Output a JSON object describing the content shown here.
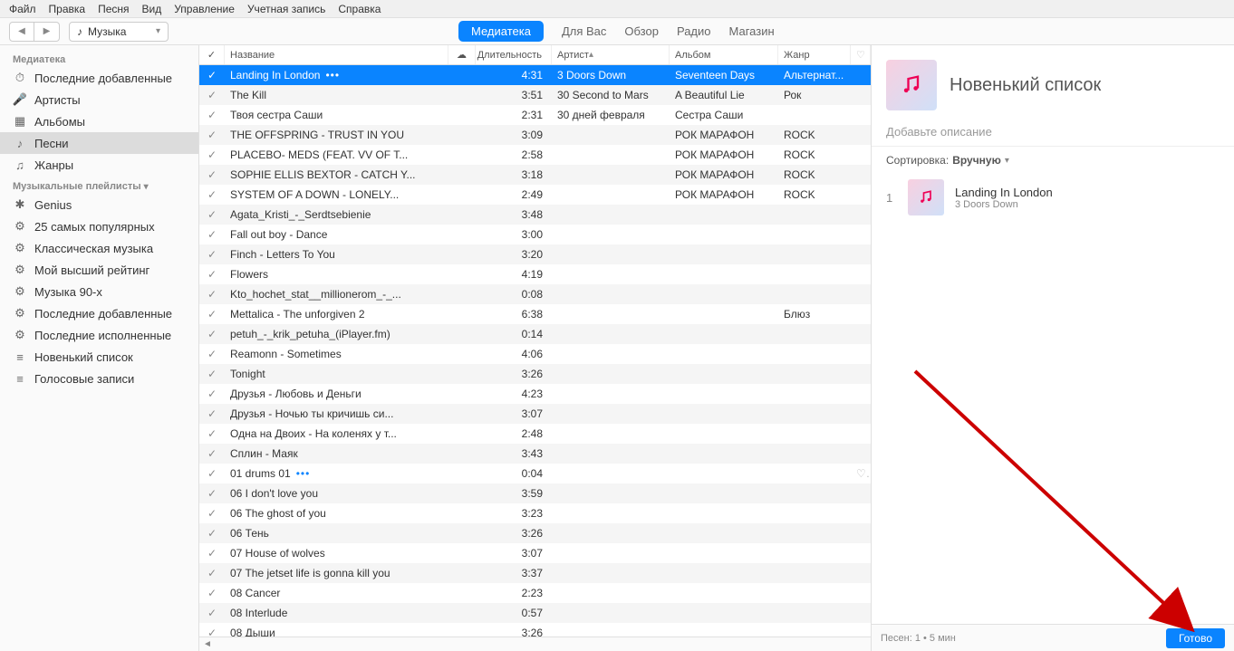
{
  "menu": [
    "Файл",
    "Правка",
    "Песня",
    "Вид",
    "Управление",
    "Учетная запись",
    "Справка"
  ],
  "mediaSelector": {
    "label": "Музыка"
  },
  "topTabs": [
    {
      "label": "Медиатека",
      "active": true
    },
    {
      "label": "Для Вас",
      "active": false
    },
    {
      "label": "Обзор",
      "active": false
    },
    {
      "label": "Радио",
      "active": false
    },
    {
      "label": "Магазин",
      "active": false
    }
  ],
  "sidebar": {
    "libraryHeader": "Медиатека",
    "libraryItems": [
      {
        "label": "Последние добавленные",
        "icon": "clock"
      },
      {
        "label": "Артисты",
        "icon": "mic"
      },
      {
        "label": "Альбомы",
        "icon": "album"
      },
      {
        "label": "Песни",
        "icon": "note",
        "selected": true
      },
      {
        "label": "Жанры",
        "icon": "genre"
      }
    ],
    "playlistsHeader": "Музыкальные плейлисты",
    "playlistItems": [
      {
        "label": "Genius",
        "icon": "atom"
      },
      {
        "label": "25 самых популярных",
        "icon": "gear"
      },
      {
        "label": "Классическая музыка",
        "icon": "gear"
      },
      {
        "label": "Мой высший рейтинг",
        "icon": "gear"
      },
      {
        "label": "Музыка 90-х",
        "icon": "gear"
      },
      {
        "label": "Последние добавленные",
        "icon": "gear"
      },
      {
        "label": "Последние исполненные",
        "icon": "gear"
      },
      {
        "label": "Новенький список",
        "icon": "list"
      },
      {
        "label": "Голосовые записи",
        "icon": "list"
      }
    ]
  },
  "columns": {
    "name": "Название",
    "cloud": "",
    "duration": "Длительность",
    "artist": "Артист",
    "album": "Альбом",
    "genre": "Жанр"
  },
  "rows": [
    {
      "name": "Landing In London",
      "dur": "4:31",
      "artist": "3 Doors Down",
      "album": "Seventeen Days",
      "genre": "Альтернат...",
      "selected": true,
      "dots": true
    },
    {
      "name": "The Kill",
      "dur": "3:51",
      "artist": "30 Second to Mars",
      "album": "A Beautiful Lie",
      "genre": "Рок"
    },
    {
      "name": "Твоя сестра Саши",
      "dur": "2:31",
      "artist": "30 дней февраля",
      "album": "Сестра Саши",
      "genre": ""
    },
    {
      "name": "THE OFFSPRING - TRUST IN YOU",
      "dur": "3:09",
      "artist": "",
      "album": "РОК МАРАФОН",
      "genre": "ROCK"
    },
    {
      "name": "PLACEBO- MEDS (FEAT. VV OF T...",
      "dur": "2:58",
      "artist": "",
      "album": "РОК МАРАФОН",
      "genre": "ROCK"
    },
    {
      "name": "SOPHIE ELLIS BEXTOR - CATCH Y...",
      "dur": "3:18",
      "artist": "",
      "album": "РОК МАРАФОН",
      "genre": "ROCK"
    },
    {
      "name": "SYSTEM OF A DOWN - LONELY...",
      "dur": "2:49",
      "artist": "",
      "album": "РОК МАРАФОН",
      "genre": "ROCK"
    },
    {
      "name": "Agata_Kristi_-_Serdtsebienie",
      "dur": "3:48",
      "artist": "",
      "album": "",
      "genre": ""
    },
    {
      "name": "Fall out boy - Dance",
      "dur": "3:00",
      "artist": "",
      "album": "",
      "genre": ""
    },
    {
      "name": "Finch - Letters To You",
      "dur": "3:20",
      "artist": "",
      "album": "",
      "genre": ""
    },
    {
      "name": "Flowers",
      "dur": "4:19",
      "artist": "",
      "album": "",
      "genre": ""
    },
    {
      "name": "Kto_hochet_stat__millionerom_-_...",
      "dur": "0:08",
      "artist": "",
      "album": "",
      "genre": ""
    },
    {
      "name": "Mettalica - The unforgiven 2",
      "dur": "6:38",
      "artist": "",
      "album": "",
      "genre": "Блюз"
    },
    {
      "name": "petuh_-_krik_petuha_(iPlayer.fm)",
      "dur": "0:14",
      "artist": "",
      "album": "",
      "genre": ""
    },
    {
      "name": "Reamonn - Sometimes",
      "dur": "4:06",
      "artist": "",
      "album": "",
      "genre": ""
    },
    {
      "name": "Tonight",
      "dur": "3:26",
      "artist": "",
      "album": "",
      "genre": ""
    },
    {
      "name": "Друзья - Любовь и Деньги",
      "dur": "4:23",
      "artist": "",
      "album": "",
      "genre": ""
    },
    {
      "name": "Друзья - Ночью ты кричишь си...",
      "dur": "3:07",
      "artist": "",
      "album": "",
      "genre": ""
    },
    {
      "name": "Одна на Двоих - На коленях у т...",
      "dur": "2:48",
      "artist": "",
      "album": "",
      "genre": ""
    },
    {
      "name": "Сплин - Маяк",
      "dur": "3:43",
      "artist": "",
      "album": "",
      "genre": ""
    },
    {
      "name": "01 drums 01",
      "dur": "0:04",
      "artist": "",
      "album": "",
      "genre": "",
      "dots": true,
      "heart": true
    },
    {
      "name": "06 I don't love you",
      "dur": "3:59",
      "artist": "",
      "album": "",
      "genre": ""
    },
    {
      "name": "06 The ghost of you",
      "dur": "3:23",
      "artist": "",
      "album": "",
      "genre": ""
    },
    {
      "name": "06 Тень",
      "dur": "3:26",
      "artist": "",
      "album": "",
      "genre": ""
    },
    {
      "name": "07 House of wolves",
      "dur": "3:07",
      "artist": "",
      "album": "",
      "genre": ""
    },
    {
      "name": "07 The jetset life is gonna kill you",
      "dur": "3:37",
      "artist": "",
      "album": "",
      "genre": ""
    },
    {
      "name": "08 Cancer",
      "dur": "2:23",
      "artist": "",
      "album": "",
      "genre": ""
    },
    {
      "name": "08 Interlude",
      "dur": "0:57",
      "artist": "",
      "album": "",
      "genre": ""
    },
    {
      "name": "08 Дыши",
      "dur": "3:26",
      "artist": "",
      "album": "",
      "genre": ""
    }
  ],
  "playlist": {
    "title": "Новенький список",
    "desc": "Добавьте описание",
    "sortLabel": "Сортировка:",
    "sortValue": "Вручную",
    "tracks": [
      {
        "idx": "1",
        "name": "Landing In London",
        "sub": "3 Doors Down"
      }
    ],
    "footer": "Песен: 1 • 5 мин",
    "doneLabel": "Готово"
  }
}
